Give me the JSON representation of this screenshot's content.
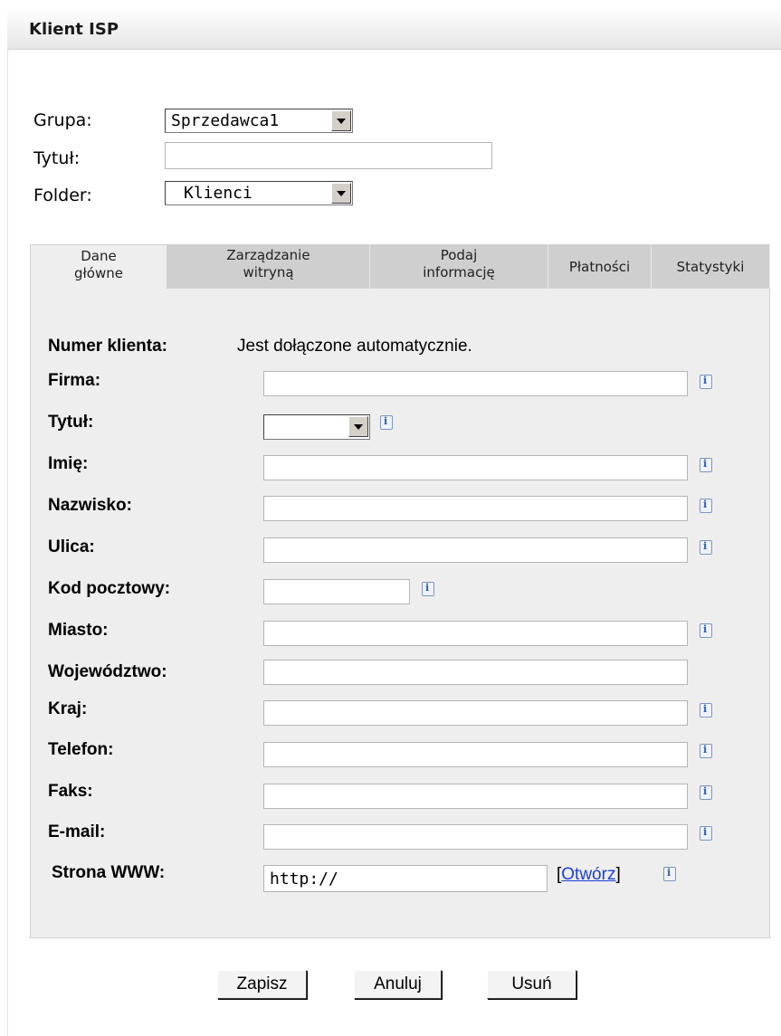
{
  "header": {
    "title": "Klient ISP"
  },
  "top": {
    "grupa_label": "Grupa:",
    "grupa_value": "Sprzedawca1",
    "tytul_label": "Tytuł:",
    "tytul_value": "",
    "folder_label": "Folder:",
    "folder_value": "Klienci"
  },
  "tabs": [
    {
      "label": "Dane\ngłówne",
      "active": true
    },
    {
      "label": "Zarządzanie\nwitryną",
      "active": false
    },
    {
      "label": "Podaj\ninformację",
      "active": false
    },
    {
      "label": "Płatności",
      "active": false
    },
    {
      "label": "Statystyki",
      "active": false
    }
  ],
  "form": {
    "numer_label": "Numer klienta:",
    "numer_value": "Jest dołączone automatycznie.",
    "firma_label": "Firma:",
    "tytul_label": "Tytuł:",
    "imie_label": "Imię:",
    "nazwisko_label": "Nazwisko:",
    "ulica_label": "Ulica:",
    "kod_label": "Kod pocztowy:",
    "miasto_label": "Miasto:",
    "wojewodztwo_label": "Województwo:",
    "kraj_label": "Kraj:",
    "telefon_label": "Telefon:",
    "faks_label": "Faks:",
    "email_label": "E-mail:",
    "www_label": "Strona WWW:",
    "www_value": "http://",
    "open_link": "Otwórz"
  },
  "buttons": {
    "save": "Zapisz",
    "cancel": "Anuluj",
    "delete": "Usuń"
  },
  "colors": {
    "panel": "#eeeeee",
    "tab_inactive": "#cfcfcf",
    "link": "#1a3fd6"
  }
}
